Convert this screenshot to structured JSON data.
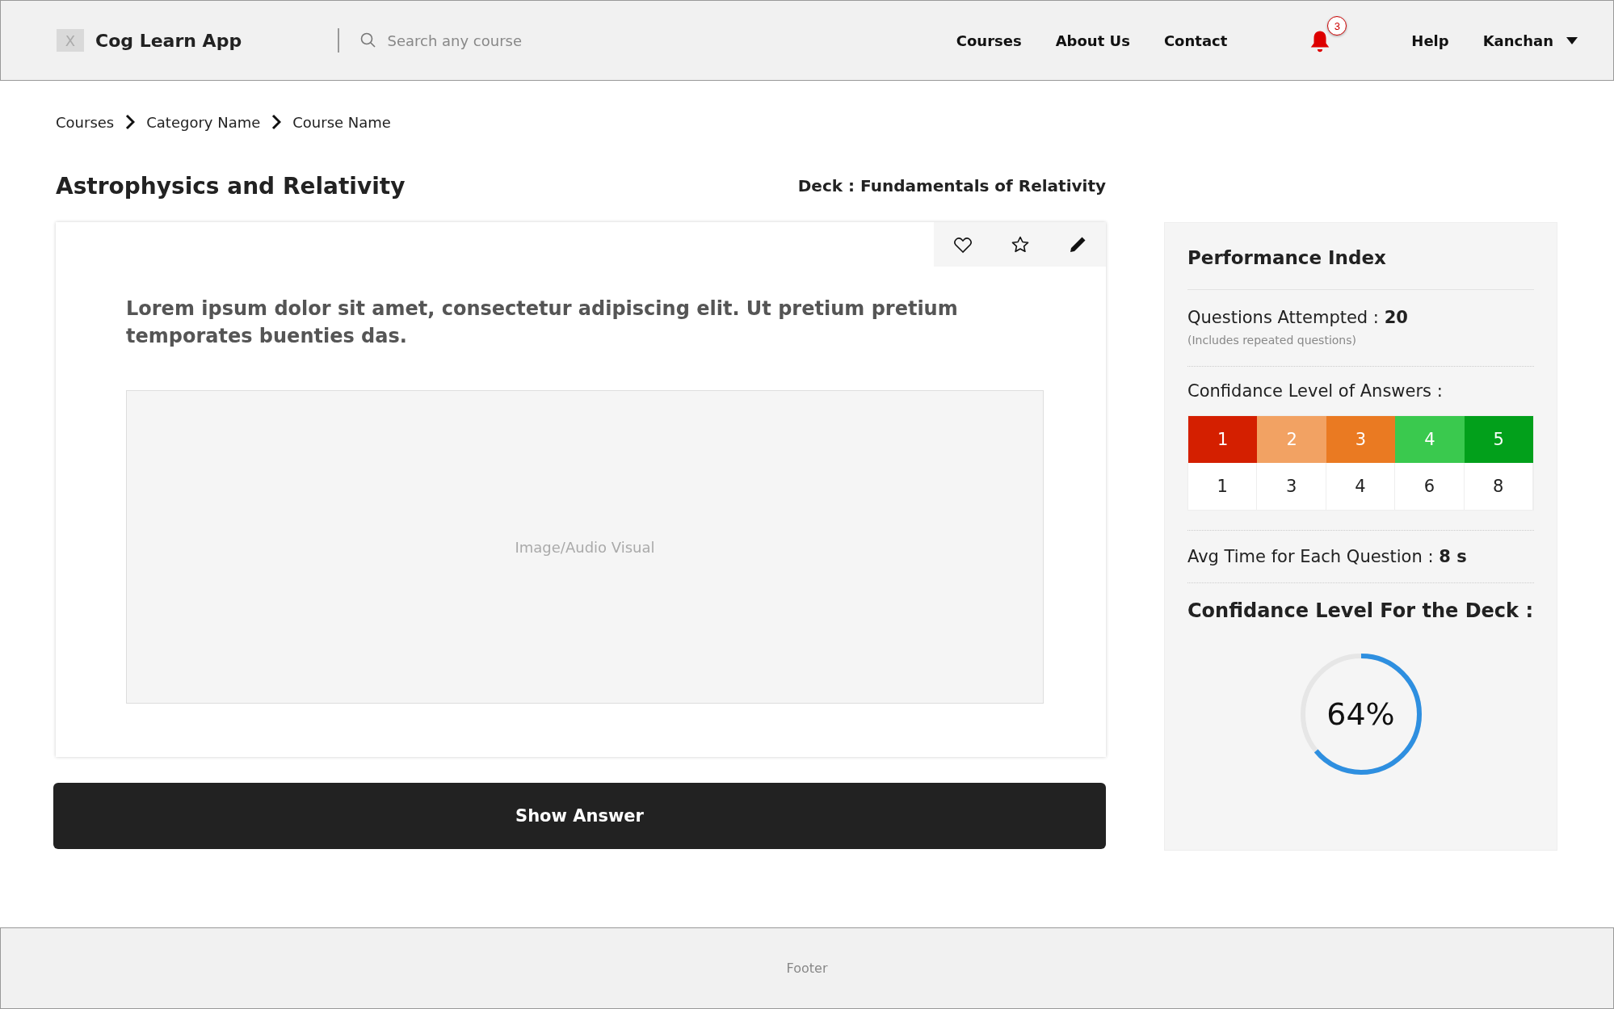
{
  "header": {
    "logo_mark": "X",
    "app_name": "Cog Learn App",
    "search": {
      "placeholder": "Search any course"
    },
    "nav": [
      "Courses",
      "About Us",
      "Contact"
    ],
    "notifications": {
      "count": "3"
    },
    "help": "Help",
    "user": "Kanchan"
  },
  "breadcrumb": [
    "Courses",
    "Category Name",
    "Course Name"
  ],
  "course_title": "Astrophysics and Relativity",
  "deck": "Deck : Fundamentals of Relativity",
  "card": {
    "question": "Lorem ipsum dolor sit amet, consectetur adipiscing elit. Ut pretium pretium temporates buenties das.",
    "media_placeholder": "Image/Audio Visual"
  },
  "show_answer": "Show Answer",
  "performance": {
    "title": "Performance Index",
    "questions_attempted": "Questions Attempted : **20**",
    "note": "(Includes repeated questions)",
    "confidence_label": "Confidance Level of Answers :",
    "levels": [
      {
        "label": "1",
        "count": "1",
        "color": "#d41f00"
      },
      {
        "label": "2",
        "count": "3",
        "color": "#f2a263"
      },
      {
        "label": "3",
        "count": "4",
        "color": "#ea7a22"
      },
      {
        "label": "4",
        "count": "6",
        "color": "#3ac94e"
      },
      {
        "label": "5",
        "count": "8",
        "color": "#02a01b"
      }
    ],
    "avg_time": "Avg Time for Each Question : **8 s**",
    "deck_confidence_label": "Confidance Level For the Deck :",
    "deck_confidence": {
      "level": 0.64,
      "reading": "64%"
    }
  },
  "footer": "Footer"
}
